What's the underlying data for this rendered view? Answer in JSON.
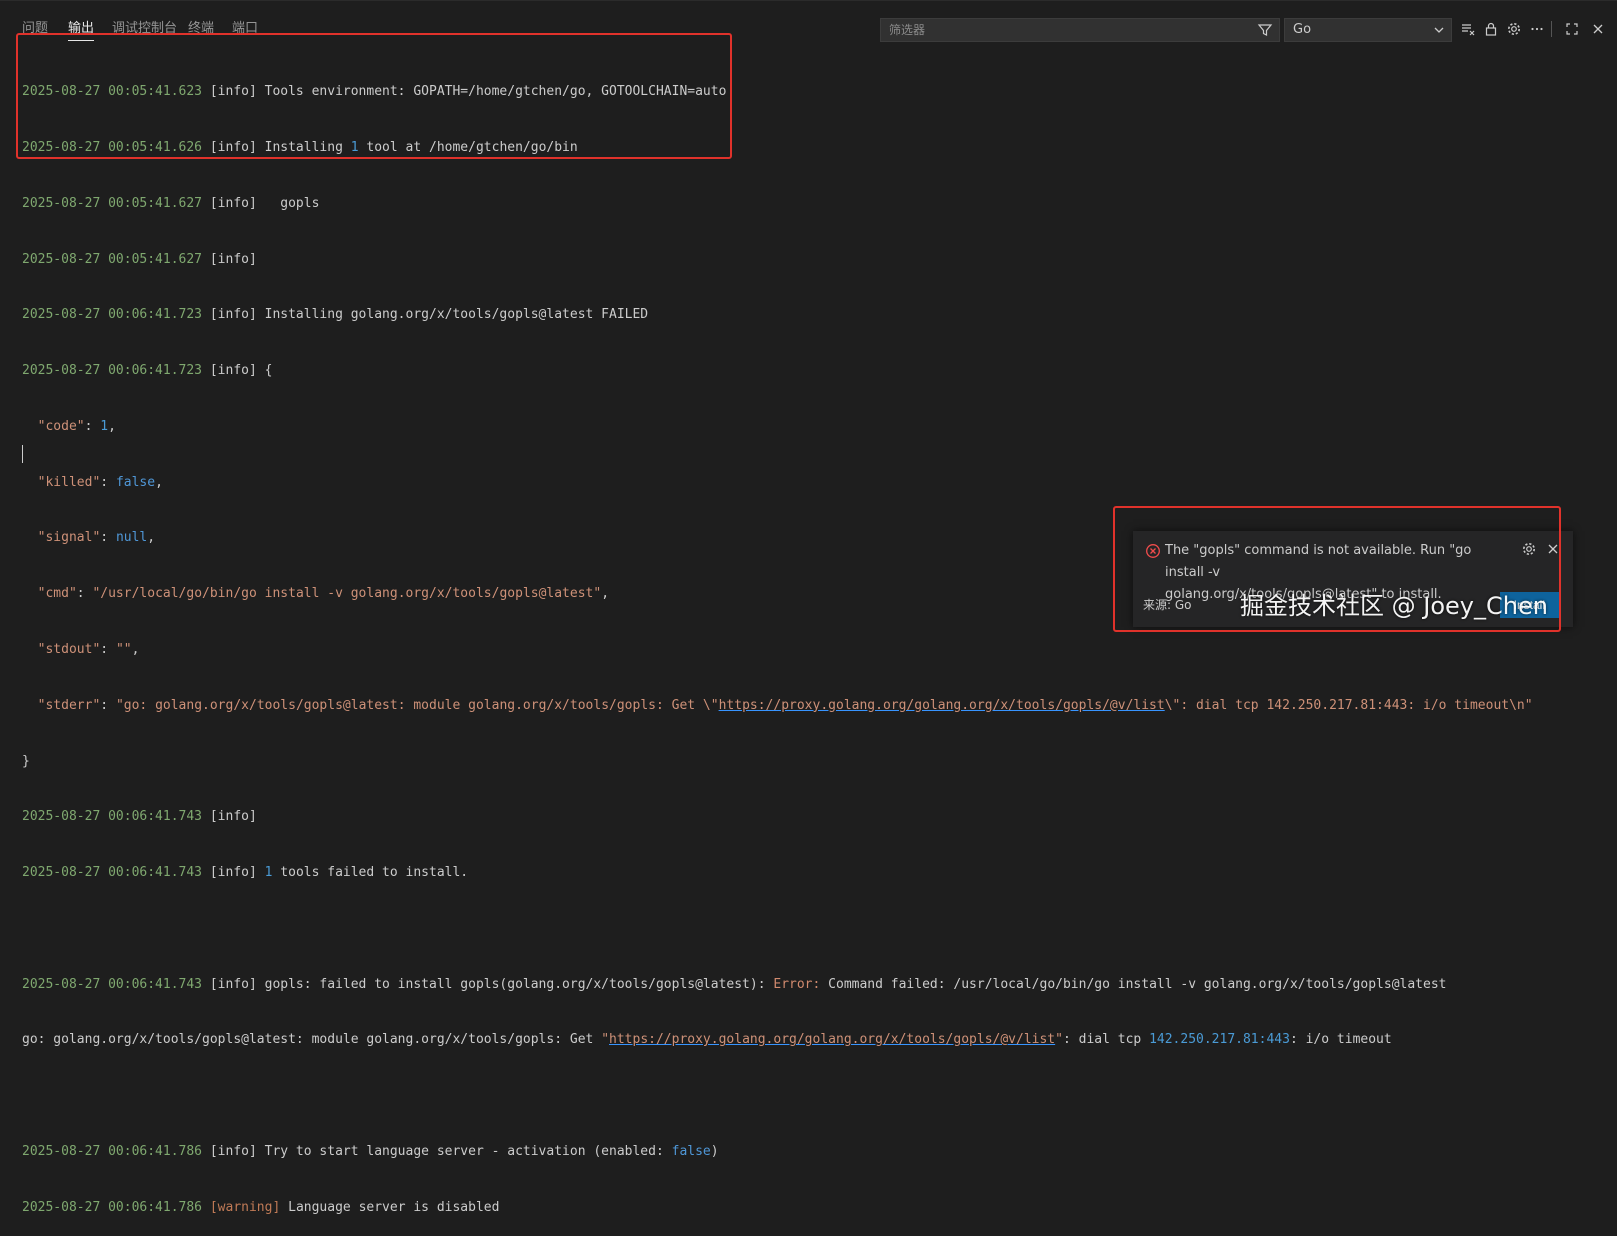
{
  "tabs": [
    {
      "label": "问题"
    },
    {
      "label": "输出"
    },
    {
      "label": "调试控制台"
    },
    {
      "label": "终端"
    },
    {
      "label": "端口"
    }
  ],
  "filter": {
    "placeholder": "筛选器",
    "value": ""
  },
  "channel_select": {
    "value": "Go"
  },
  "icons": {
    "filter": "filter-icon",
    "chevron": "chevron-down-icon",
    "clear": "clear-all-icon",
    "lock": "lock-icon",
    "gear": "gear-icon",
    "more": "more-icon",
    "maximize": "maximize-icon",
    "close": "close-icon",
    "error": "error-circle-icon"
  },
  "log": {
    "l1": {
      "ts": "2025-08-27 00:05:41.623",
      "text": " [info] Tools environment: GOPATH=/home/gtchen/go, GOTOOLCHAIN=auto"
    },
    "l2": {
      "ts": "2025-08-27 00:05:41.626",
      "pre": " [info] Installing ",
      "num": "1",
      "post": " tool at /home/gtchen/go/bin"
    },
    "l3": {
      "ts": "2025-08-27 00:05:41.627",
      "text": " [info]   gopls"
    },
    "l4": {
      "ts": "2025-08-27 00:05:41.627",
      "text": " [info]"
    },
    "l5": {
      "ts": "2025-08-27 00:06:41.723",
      "text": " [info] Installing golang.org/x/tools/gopls@latest FAILED"
    },
    "l6": {
      "ts": "2025-08-27 00:06:41.723",
      "text": " [info] {"
    },
    "j1": {
      "key": "  \"code\"",
      "sep": ": ",
      "val": "1",
      "end": ","
    },
    "j2": {
      "key": "  \"killed\"",
      "sep": ": ",
      "val": "false",
      "end": ","
    },
    "j3": {
      "key": "  \"signal\"",
      "sep": ": ",
      "val": "null",
      "end": ","
    },
    "j4": {
      "key": "  \"cmd\"",
      "sep": ": ",
      "val": "\"/usr/local/go/bin/go install -v golang.org/x/tools/gopls@latest\"",
      "end": ","
    },
    "j5": {
      "key": "  \"stdout\"",
      "sep": ": ",
      "val": "\"\"",
      "end": ","
    },
    "j6": {
      "key": "  \"stderr\"",
      "sep": ": ",
      "pre": "\"go: golang.org/x/tools/gopls@latest: module golang.org/x/tools/gopls: Get \\\"",
      "link": "https://proxy.golang.org/golang.org/x/tools/gopls/@v/list",
      "post": "\\\": dial tcp 142.250.217.81:443: i/o timeout\\n\""
    },
    "j7": {
      "text": "}"
    },
    "l7": {
      "ts": "2025-08-27 00:06:41.743",
      "text": " [info]"
    },
    "l8": {
      "ts": "2025-08-27 00:06:41.743",
      "pre": " [info] ",
      "num": "1",
      "post": " tools failed to install."
    },
    "l9": {
      "ts": "2025-08-27 00:06:41.743",
      "pre": " [info] gopls: failed to install gopls(golang.org/x/tools/gopls@latest): ",
      "err": "Error:",
      "post": " Command failed: /usr/local/go/bin/go install -v golang.org/x/tools/gopls@latest"
    },
    "l10": {
      "pre": "go: golang.org/x/tools/gopls@latest: module golang.org/x/tools/gopls: Get ",
      "q1": "\"",
      "link": "https://proxy.golang.org/golang.org/x/tools/gopls/@v/list",
      "q2": "\"",
      "mid": ": dial tcp ",
      "ip": "142.250.217.81:443",
      "post": ": i/o timeout"
    },
    "l11": {
      "ts": "2025-08-27 00:06:41.786",
      "pre": " [info] Try to start language server - activation (enabled: ",
      "kw": "false",
      "post": ")"
    },
    "l12": {
      "ts": "2025-08-27 00:06:41.786",
      "warn": " [warning]",
      "post": " Language server is disabled"
    }
  },
  "notification": {
    "message_line1": "The \"gopls\" command is not available. Run \"go install -v",
    "message_line2": "golang.org/x/tools/gopls@latest\" to install.",
    "source": "来源: Go",
    "button": "Install"
  },
  "watermark": "掘金技术社区 @ Joey_Chen",
  "colors": {
    "highlight": "#e0322b",
    "accent": "#3794ff",
    "button": "#0e639c"
  }
}
